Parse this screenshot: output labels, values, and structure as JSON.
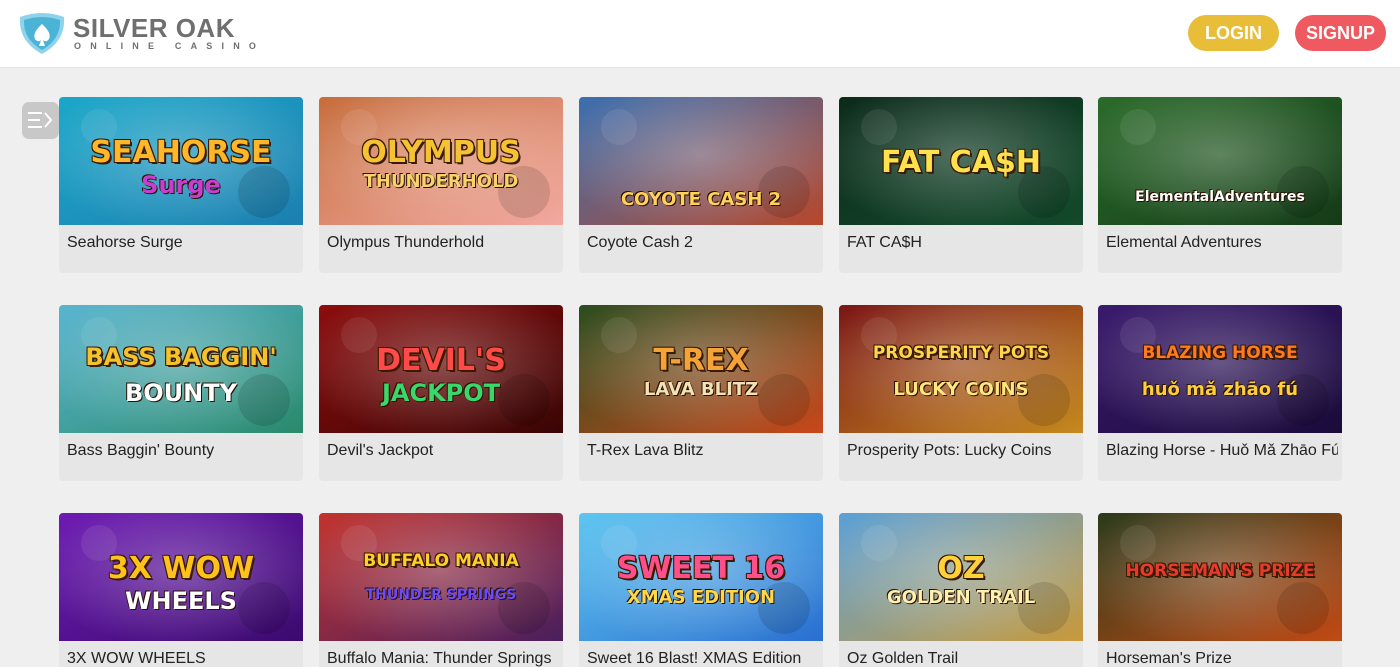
{
  "brand": {
    "name": "SILVER OAK",
    "tagline": "ONLINE CASINO"
  },
  "header": {
    "login_label": "LOGIN",
    "signup_label": "SIGNUP"
  },
  "colors": {
    "login": "#e8bd38",
    "signup": "#ef5a60",
    "logo_blue": "#4ab3d6",
    "logo_gray": "#6f6f6f"
  },
  "sidebar_toggle_icon": "menu-collapse-icon",
  "games": [
    {
      "title": "Seahorse Surge",
      "art_line1": "SEAHORSE",
      "art_line2": "Surge",
      "bg": [
        "#1ba7c9",
        "#1c7fb0"
      ],
      "fg": "#ffb629",
      "fg2": "#c83fd0"
    },
    {
      "title": "Olympus Thunderhold",
      "art_line1": "OLYMPUS",
      "art_line2": "THUNDERHOLD",
      "bg": [
        "#c66d3c",
        "#f2a9a0"
      ],
      "fg": "#f4c233",
      "fg2": "#f7d46b"
    },
    {
      "title": "Coyote Cash 2",
      "art_line1": "",
      "art_line2": "COYOTE CASH 2",
      "bg": [
        "#3a6fb0",
        "#b8482b"
      ],
      "fg": "#f4c233",
      "fg2": "#ffd35a"
    },
    {
      "title": "FAT CA$H",
      "art_line1": "FAT CA$H",
      "art_line2": "",
      "bg": [
        "#0d2b1c",
        "#124a2a"
      ],
      "fg": "#ffe14d",
      "fg2": "#2fbf5a"
    },
    {
      "title": "Elemental Adventures",
      "art_line1": "",
      "art_line2": "ElementalAdventures",
      "bg": [
        "#2b6b2a",
        "#143b17"
      ],
      "fg": "#ffd54a",
      "fg2": "#ffffff"
    },
    {
      "title": "Bass Baggin' Bounty",
      "art_line1": "BASS BAGGIN'",
      "art_line2": "BOUNTY",
      "bg": [
        "#59b5cf",
        "#2a8a6c"
      ],
      "fg": "#f3c22d",
      "fg2": "#ffffff"
    },
    {
      "title": "Devil's Jackpot",
      "art_line1": "DEVIL'S",
      "art_line2": "JACKPOT",
      "bg": [
        "#8c0d0d",
        "#3a0505"
      ],
      "fg": "#ff4a4a",
      "fg2": "#38d86a"
    },
    {
      "title": "T-Rex Lava Blitz",
      "art_line1": "T-REX",
      "art_line2": "LAVA BLITZ",
      "bg": [
        "#2b4d1e",
        "#c9481c"
      ],
      "fg": "#f4a338",
      "fg2": "#f2e2b8"
    },
    {
      "title": "Prosperity Pots: Lucky Coins",
      "art_line1": "PROSPERITY POTS",
      "art_line2": "LUCKY COINS",
      "bg": [
        "#7b1616",
        "#c58a1f"
      ],
      "fg": "#ffd54a",
      "fg2": "#ffe680"
    },
    {
      "title": "Blazing Horse - Huǒ Mǎ Zhāo Fú",
      "art_line1": "BLAZING HORSE",
      "art_line2": "huǒ mǎ zhāo fú",
      "bg": [
        "#3a1a6e",
        "#1a0b3a"
      ],
      "fg": "#ff7a1a",
      "fg2": "#ffcf3a"
    },
    {
      "title": "3X WOW WHEELS",
      "art_line1": "3X WOW",
      "art_line2": "WHEELS",
      "bg": [
        "#6d1bb3",
        "#3b0a6e"
      ],
      "fg": "#ffc21a",
      "fg2": "#ffffff"
    },
    {
      "title": "Buffalo Mania: Thunder Springs",
      "art_line1": "BUFFALO MANIA",
      "art_line2": "THUNDER SPRINGS",
      "bg": [
        "#c2332e",
        "#4a1f5e"
      ],
      "fg": "#ffcf2a",
      "fg2": "#6a4cff"
    },
    {
      "title": "Sweet 16 Blast! XMAS Edition",
      "art_line1": "SWEET 16",
      "art_line2": "XMAS EDITION",
      "bg": [
        "#5fc6f0",
        "#2a6fd0"
      ],
      "fg": "#ff4f8a",
      "fg2": "#ffd84a"
    },
    {
      "title": "Oz Golden Trail",
      "art_line1": "OZ",
      "art_line2": "GOLDEN TRAIL",
      "bg": [
        "#5aa0d8",
        "#c99a3a"
      ],
      "fg": "#ffd23a",
      "fg2": "#fff2b0"
    },
    {
      "title": "Horseman's Prize",
      "art_line1": "HORSEMAN'S PRIZE",
      "art_line2": "",
      "bg": [
        "#2a3a1a",
        "#c24a14"
      ],
      "fg": "#e83a2a",
      "fg2": "#ff9a2a"
    }
  ]
}
